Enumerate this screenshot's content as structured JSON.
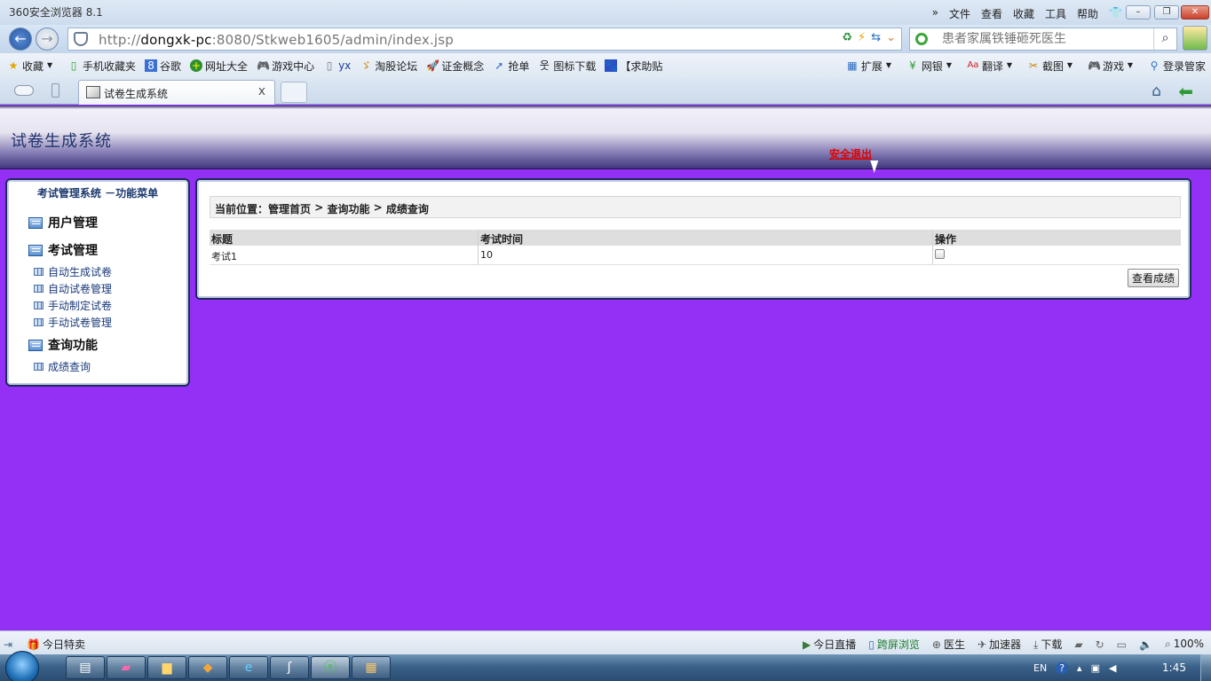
{
  "browser": {
    "app_title": "360安全浏览器 8.1",
    "menu": [
      "文件",
      "查看",
      "收藏",
      "工具",
      "帮助"
    ],
    "address": {
      "scheme": "http://",
      "host": "dongxk-pc",
      "rest": ":8080/Stkweb1605/admin/index.jsp"
    },
    "search_placeholder": "患者家属铁锤砸死医生",
    "bookmarks": [
      "收藏",
      "手机收藏夹",
      "谷歌",
      "网址大全",
      "游戏中心",
      "yx",
      "淘股论坛",
      "证金概念",
      "抢单",
      "图标下载",
      "【求助贴"
    ],
    "bookmarks_right": [
      "扩展",
      "网银",
      "翻译",
      "截图",
      "游戏",
      "登录管家"
    ],
    "tab_title": "试卷生成系统",
    "tab_close": "x"
  },
  "page": {
    "system_title": "试卷生成系统",
    "logout_label": "安全退出"
  },
  "sidebar": {
    "title": "考试管理系统 －功能菜单",
    "groups": [
      {
        "label": "用户管理",
        "items": []
      },
      {
        "label": "考试管理",
        "items": [
          "自动生成试卷",
          "自动试卷管理",
          "手动制定试卷",
          "手动试卷管理"
        ]
      },
      {
        "label": "查询功能",
        "items": [
          "成绩查询"
        ]
      }
    ]
  },
  "content": {
    "breadcrumb": {
      "prefix": "当前位置：",
      "parts": [
        "管理首页",
        "查询功能",
        "成绩查询"
      ],
      "sep": " > "
    },
    "table": {
      "headers": [
        "标题",
        "考试时间",
        "操作"
      ],
      "rows": [
        {
          "title": "考试1",
          "time": "10"
        }
      ]
    },
    "view_button": "查看成绩"
  },
  "statusbar": {
    "left": [
      "今日特卖"
    ],
    "right": [
      "今日直播",
      "跨屏浏览",
      "医生",
      "加速器",
      "下载",
      "100%"
    ]
  },
  "taskbar": {
    "tray_lang": "EN",
    "clock": "1:45"
  }
}
